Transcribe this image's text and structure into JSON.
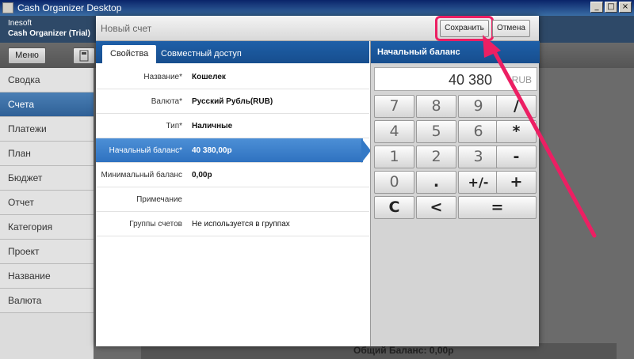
{
  "window": {
    "title": "Cash Organizer Desktop",
    "minimize": "_",
    "maximize": "□",
    "close": "×"
  },
  "header": {
    "company": "Inesoft",
    "product": "Cash Organizer (Trial)"
  },
  "toolbar": {
    "menu_label": "Меню"
  },
  "sidebar": {
    "items": [
      "Сводка",
      "Счета",
      "Платежи",
      "План",
      "Бюджет",
      "Отчет",
      "Категория",
      "Проект",
      "Название",
      "Валюта"
    ]
  },
  "background": {
    "footer_text": "Общий Баланс: 0,00р"
  },
  "dialog": {
    "title": "Новый счет",
    "save_label": "Сохранить",
    "cancel_label": "Отмена",
    "tabs": [
      "Свойства",
      "Совместный доступ"
    ],
    "fields": [
      {
        "label": "Название*",
        "value": "Кошелек"
      },
      {
        "label": "Валюта*",
        "value": "Русский Рубль(RUB)"
      },
      {
        "label": "Тип*",
        "value": "Наличные"
      },
      {
        "label": "Начальный баланс*",
        "value": "40 380,00р"
      },
      {
        "label": "Минимальный баланс",
        "value": "0,00р"
      },
      {
        "label": "Примечание",
        "value": ""
      },
      {
        "label": "Группы счетов",
        "value": "Не используется в группах"
      }
    ]
  },
  "calculator": {
    "title": "Начальный баланс",
    "display_value": "40 380",
    "currency": "RUB",
    "keys": [
      "7",
      "8",
      "9",
      "/",
      "4",
      "5",
      "6",
      "*",
      "1",
      "2",
      "3",
      "-",
      "0",
      ".",
      "+/-",
      "+",
      "C",
      "<",
      "="
    ]
  },
  "colors": {
    "accent": "#1e5fa8",
    "highlight": "#ec1f63",
    "selected_row": "#3a7fcc"
  }
}
